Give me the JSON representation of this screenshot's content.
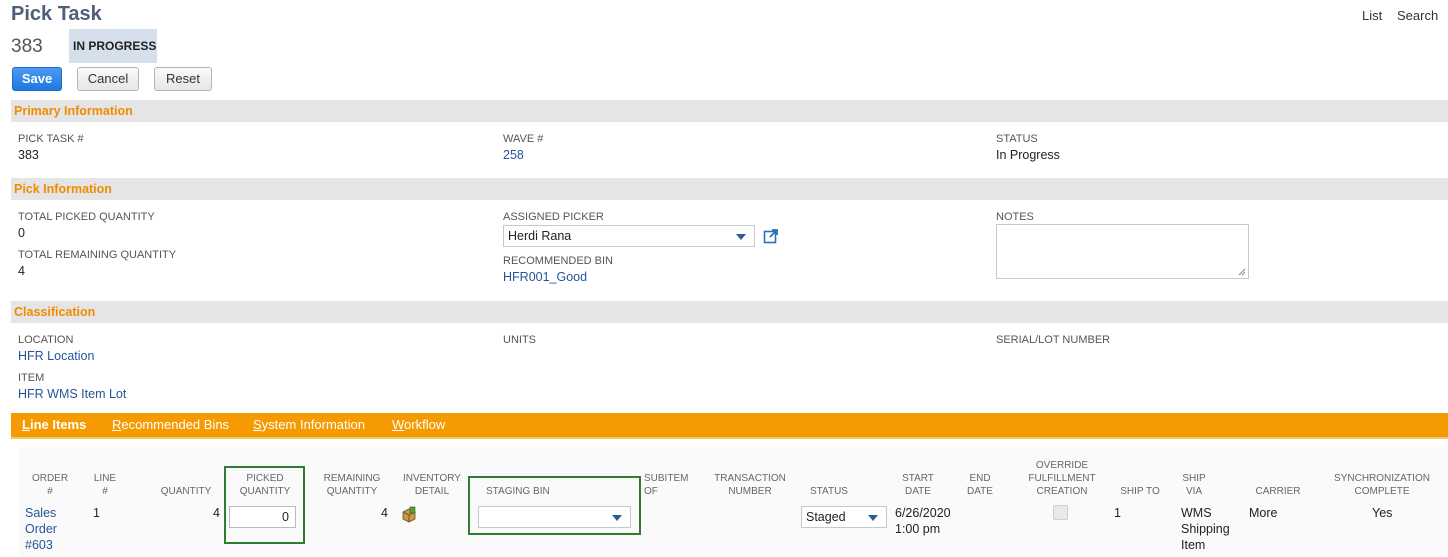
{
  "header": {
    "title": "Pick Task",
    "record_number": "383",
    "status_badge": "IN PROGRESS",
    "links": [
      "List",
      "Search"
    ]
  },
  "buttons": {
    "save": "Save",
    "cancel": "Cancel",
    "reset": "Reset"
  },
  "primary_information": {
    "section_title": "Primary Information",
    "pick_task_label": "PICK TASK #",
    "pick_task_value": "383",
    "wave_label": "WAVE #",
    "wave_value": "258",
    "status_label": "STATUS",
    "status_value": "In Progress"
  },
  "pick_information": {
    "section_title": "Pick Information",
    "total_picked_label": "TOTAL PICKED QUANTITY",
    "total_picked_value": "0",
    "total_remaining_label": "TOTAL REMAINING QUANTITY",
    "total_remaining_value": "4",
    "assigned_picker_label": "ASSIGNED PICKER",
    "assigned_picker_value": "Herdi Rana",
    "recommended_bin_label": "RECOMMENDED BIN",
    "recommended_bin_value": "HFR001_Good",
    "notes_label": "NOTES",
    "notes_value": ""
  },
  "classification": {
    "section_title": "Classification",
    "location_label": "LOCATION",
    "location_value": "HFR Location",
    "item_label": "ITEM",
    "item_value": "HFR WMS Item Lot",
    "units_label": "UNITS",
    "serial_label": "SERIAL/LOT NUMBER"
  },
  "tabs": [
    {
      "first": "L",
      "rest": "ine Items",
      "active": true
    },
    {
      "first": "R",
      "rest": "ecommended Bins",
      "active": false
    },
    {
      "first": "S",
      "rest": "ystem Information",
      "active": false
    },
    {
      "first": "W",
      "rest": "orkflow",
      "active": false
    }
  ],
  "line_items": {
    "columns": {
      "order": [
        "ORDER",
        "#"
      ],
      "line": [
        "LINE",
        "#"
      ],
      "quantity": [
        "QUANTITY"
      ],
      "picked_quantity": [
        "PICKED",
        "QUANTITY"
      ],
      "remaining_quantity": [
        "REMAINING",
        "QUANTITY"
      ],
      "inventory_detail": [
        "INVENTORY",
        "DETAIL"
      ],
      "staging_bin": [
        "STAGING BIN"
      ],
      "subitem_of": [
        "SUBITEM",
        "OF"
      ],
      "transaction_number": [
        "TRANSACTION",
        "NUMBER"
      ],
      "status": [
        "STATUS"
      ],
      "start_date": [
        "START",
        "DATE"
      ],
      "end_date": [
        "END",
        "DATE"
      ],
      "override": [
        "OVERRIDE",
        "FULFILLMENT",
        "CREATION"
      ],
      "ship_to": [
        "SHIP TO"
      ],
      "ship_via": [
        "SHIP",
        "VIA"
      ],
      "carrier": [
        "CARRIER"
      ],
      "sync": [
        "SYNCHRONIZATION",
        "COMPLETE"
      ]
    },
    "row": {
      "order": [
        "Sales",
        "Order",
        "#603"
      ],
      "line": "1",
      "quantity": "4",
      "picked_quantity": "0",
      "remaining_quantity": "4",
      "staging_bin": "",
      "status": "Staged",
      "start_date": [
        "6/26/2020",
        "1:00 pm"
      ],
      "ship_to": "1",
      "ship_via": [
        "WMS",
        "Shipping",
        "Item"
      ],
      "carrier": "More",
      "sync": "Yes"
    }
  },
  "colors": {
    "accent_orange": "#f59a00",
    "section_title": "#f08c00",
    "link": "#255599",
    "highlight_box": "#2f7d32"
  }
}
